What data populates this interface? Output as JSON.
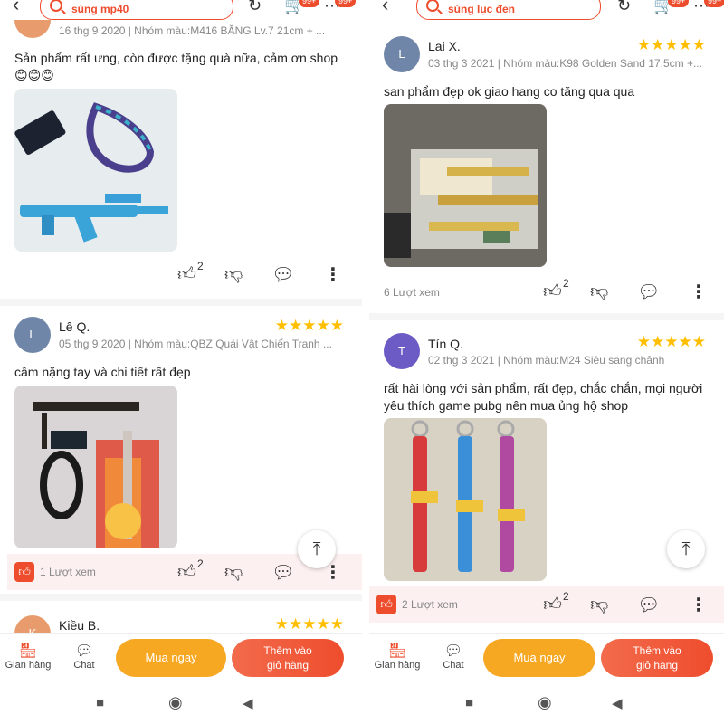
{
  "left": {
    "search_text": "súng mp40",
    "badge_cart": "99+",
    "badge_more": "99+",
    "top_review": {
      "meta": "16 thg 9 2020 | Nhóm màu:M416 BĂNG Lv.7 21cm + ...",
      "text": "Sản phẩm rất ưng, còn được tặng quà nữa, cảm ơn shop😊😊😊",
      "likes": "2"
    },
    "review2": {
      "initial": "L",
      "name": "Lê Q.",
      "stars": "★★★★★",
      "meta": "05 thg 9 2020 | Nhóm màu:QBZ Quái Vật Chiến Tranh ...",
      "text": "cầm nặng tay và chi tiết rất đẹp",
      "views": "1 Lượt xem",
      "likes": "2"
    },
    "review3": {
      "initial": "K",
      "name": "Kiều B.",
      "stars": "★★★★★"
    }
  },
  "right": {
    "search_text": "súng lục đen",
    "badge_cart": "99+",
    "badge_more": "99+",
    "review1": {
      "initial": "L",
      "name": "Lai X.",
      "stars": "★★★★★",
      "meta": "03 thg 3 2021 | Nhóm màu:K98 Golden Sand 17.5cm +...",
      "text": "san phẩm đẹp ok giao hang co tăng qua qua",
      "views": "6 Lượt xem",
      "likes": "2"
    },
    "review2": {
      "initial": "T",
      "name": "Tín Q.",
      "stars": "★★★★★",
      "meta": "02 thg 3 2021 | Nhóm màu:M24 Siêu sang chảnh",
      "text": "rất hài lòng với sản phẩm, rất đẹp, chắc chắn, mọi người yêu thích game pubg nên mua ủng hộ shop",
      "views": "2 Lượt xem",
      "likes": "2"
    }
  },
  "bottom": {
    "shop_label": "Gian hàng",
    "chat_label": "Chat",
    "buy_now": "Mua ngay",
    "add_cart_line1": "Thêm vào",
    "add_cart_line2": "giỏ hàng"
  },
  "colors": {
    "brand": "#ee4d2d",
    "star": "#ffbf00",
    "buy_now": "#f7a823",
    "avatar_gray": "#6f86a8",
    "avatar_orange": "#e89b6c",
    "avatar_purple": "#6c5bc4"
  },
  "icons": [
    "back-arrow-icon",
    "search-icon",
    "refresh-icon",
    "cart-icon",
    "more-icon",
    "thumb-up-icon",
    "thumb-down-icon",
    "comment-icon",
    "kebab-icon",
    "scroll-top-icon",
    "shop-icon",
    "chat-icon",
    "square-nav-icon",
    "circle-nav-icon",
    "triangle-nav-icon"
  ]
}
